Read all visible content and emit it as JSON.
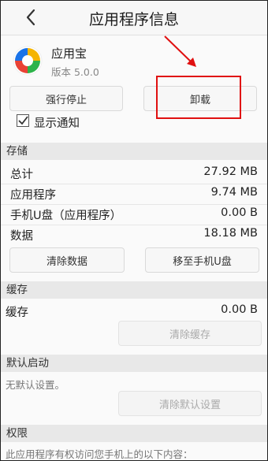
{
  "header": {
    "title": "应用程序信息"
  },
  "app": {
    "name": "应用宝",
    "version": "版本 5.0.0"
  },
  "buttons": {
    "force_stop": "强行停止",
    "uninstall": "卸载",
    "clear_data": "清除数据",
    "move_to_sd": "移至手机U盘",
    "clear_cache": "清除缓存",
    "clear_defaults": "清除默认设置"
  },
  "notification": {
    "label": "显示通知",
    "checked": true
  },
  "storage": {
    "section_title": "存储",
    "rows": [
      {
        "label": "总计",
        "value": "27.92 MB"
      },
      {
        "label": "应用程序",
        "value": "9.74 MB"
      },
      {
        "label": "手机U盘（应用程序）",
        "value": "0.00 B"
      },
      {
        "label": "数据",
        "value": "18.18 MB"
      }
    ]
  },
  "cache": {
    "section_title": "缓存",
    "label": "缓存",
    "value": "0.00 B"
  },
  "default_launch": {
    "section_title": "默认启动",
    "text": "无默认设置。"
  },
  "permissions": {
    "section_title": "权限",
    "text": "此应用程序有权访问您手机上的以下内容："
  },
  "colors": {
    "annotation": "#e01010",
    "section_bg": "#e8e8e8"
  }
}
